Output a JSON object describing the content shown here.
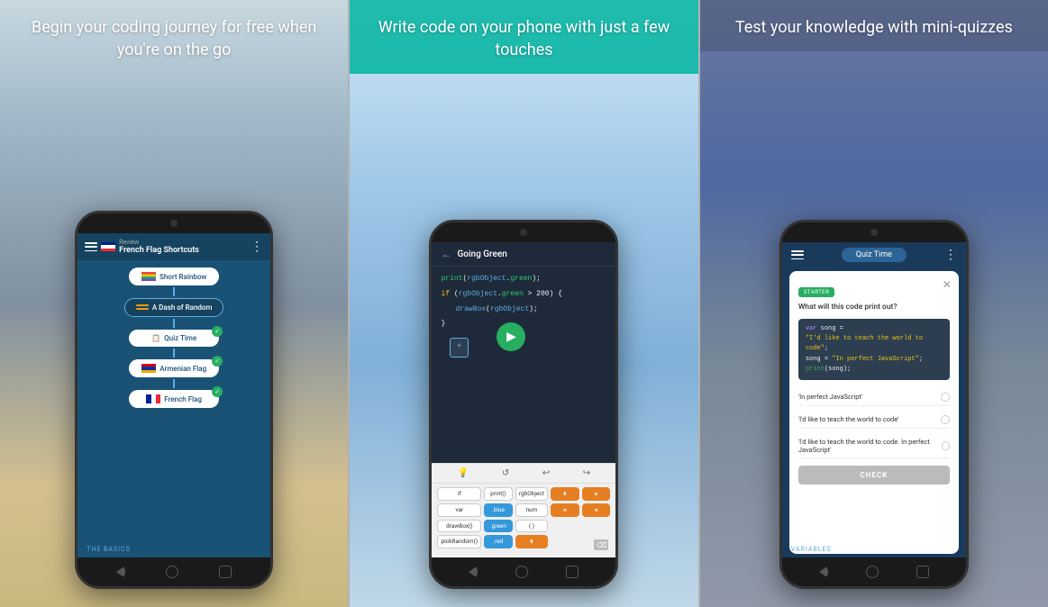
{
  "panels": [
    {
      "id": "panel-1",
      "header": "Begin your coding journey for\nfree when you're on the go",
      "bg_class": "bg-panel1",
      "phone": {
        "topbar": {
          "review_label": "Review",
          "title": "French Flag Shortcuts"
        },
        "courses": [
          {
            "name": "Short Rainbow",
            "type": "rainbow",
            "completed": false,
            "active": false
          },
          {
            "name": "A Dash of Random",
            "type": "dash",
            "completed": false,
            "active": true
          },
          {
            "name": "Quiz Time",
            "type": "quiz",
            "completed": true,
            "active": false
          },
          {
            "name": "Armenian Flag",
            "type": "armenian",
            "completed": true,
            "active": false
          },
          {
            "name": "French Flag",
            "type": "french",
            "completed": true,
            "active": false
          }
        ],
        "bottom_label": "THE BASICS"
      }
    },
    {
      "id": "panel-2",
      "header": "Write code on your phone\nwith just a few touches",
      "bg_class": "bg-panel2",
      "phone": {
        "header_title": "Going Green",
        "code_lines": [
          "print(rgbObject.green);",
          "if (rgbObject.green > 200) {",
          "    drawBox(rgbObject);",
          "}"
        ],
        "toolbar_tokens": [
          "if",
          "print()",
          "rgbObject",
          "+",
          ">",
          "var",
          ".blue",
          "num",
          "=",
          "<",
          "drawBox()",
          ".green",
          "( )",
          "",
          "",
          "pickRandom()",
          ".red",
          "+",
          "",
          ""
        ]
      }
    },
    {
      "id": "panel-3",
      "header": "Test your knowledge with\nmini-quizzes",
      "bg_class": "bg-panel3",
      "phone": {
        "header_title": "Quiz Time",
        "quiz": {
          "badge": "STARTER",
          "question": "What will this code print out?",
          "code": [
            "var song =",
            "\"I'd like to teach the world to code\";",
            "song = \"In perfect JavaScript\";",
            "print(song);"
          ],
          "options": [
            "'In perfect JavaScript'",
            "'I'd like to teach the world to code'",
            "'I'd like to teach the world to code. In perfect JavaScript'"
          ],
          "check_button": "CHECK"
        },
        "bottom_label": "VARIABLES"
      }
    }
  ],
  "icons": {
    "hamburger": "☰",
    "back_arrow": "←",
    "dots_menu": "⋮",
    "play": "▶",
    "close": "✕",
    "check": "✓",
    "lightbulb": "💡",
    "refresh": "↺",
    "undo": "↩",
    "redo": "↪",
    "delete": "⌫"
  }
}
